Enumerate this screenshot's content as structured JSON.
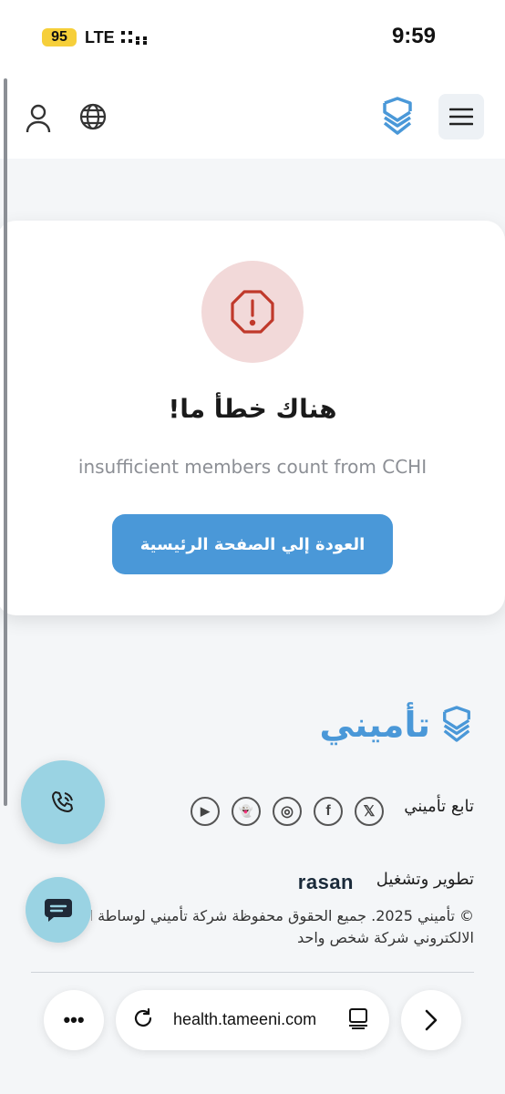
{
  "status_bar": {
    "battery": "95",
    "network": "LTE",
    "time": "9:59"
  },
  "header": {
    "icons": {
      "user": "user-icon",
      "language": "globe-icon",
      "brand": "shield-logo-icon",
      "menu": "hamburger-menu-icon"
    }
  },
  "error": {
    "title": "هناك خطأ ما!",
    "message": "insufficient members count from CCHI",
    "button_label": "العودة إلي الصفحة الرئيسية",
    "icon": "alert-hexagon-icon"
  },
  "footer": {
    "logo_text": "تأميني",
    "follow_label": "تابع تأميني",
    "social": [
      {
        "name": "x",
        "glyph": "𝕏"
      },
      {
        "name": "facebook",
        "glyph": "f"
      },
      {
        "name": "instagram",
        "glyph": "◎"
      },
      {
        "name": "snapchat",
        "glyph": "👻"
      },
      {
        "name": "youtube",
        "glyph": "▶"
      }
    ],
    "dev_label": "تطوير وتشغيل",
    "dev_company": "rasan",
    "copyright_line1": "© تأميني 2025. جميع الحقوق محفوظة شركة تأميني لوساطة ال",
    "copyright_line2": "الالكتروني شركة شخص واحد"
  },
  "browser": {
    "url": "health.tameeni.com",
    "more": "•••"
  },
  "colors": {
    "primary": "#4a98d8",
    "alert_bg": "#f2d9d9",
    "alert_icon": "#c0392b",
    "fab": "#9ad3e3"
  }
}
